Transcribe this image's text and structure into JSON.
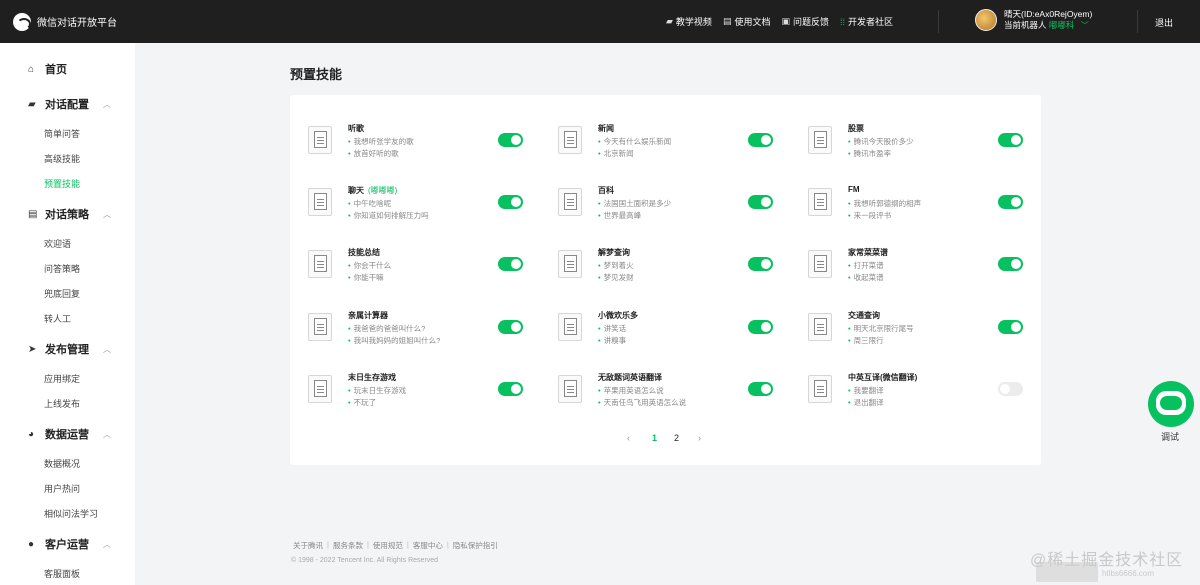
{
  "app": {
    "brand": "微信对话开放平台"
  },
  "topnav": [
    {
      "label": "教学视频",
      "icon": "video-icon"
    },
    {
      "label": "使用文档",
      "icon": "doc-icon"
    },
    {
      "label": "问题反馈",
      "icon": "feedback-icon"
    },
    {
      "label": "开发者社区",
      "icon": "community-icon"
    }
  ],
  "user": {
    "name": "晴天(ID:eAx0RejOyem)",
    "bot_prefix": "当前机器人",
    "bot_name": "嘟嘟科"
  },
  "logout": "退出",
  "sidebar": {
    "home": "首页",
    "dialog_config": {
      "label": "对话配置",
      "items": [
        "简单问答",
        "高级技能",
        "预置技能"
      ]
    },
    "dialog_strategy": {
      "label": "对话策略",
      "items": [
        "欢迎语",
        "问答策略",
        "兜底回复",
        "转人工"
      ]
    },
    "publish": {
      "label": "发布管理",
      "items": [
        "应用绑定",
        "上线发布"
      ]
    },
    "data_ops": {
      "label": "数据运营",
      "items": [
        "数据概况",
        "用户热问",
        "相似问法学习"
      ]
    },
    "customer_ops": {
      "label": "客户运营",
      "items": [
        "客服面板"
      ]
    }
  },
  "page_title": "预置技能",
  "skills": [
    {
      "name": "听歌",
      "tag": "",
      "examples": [
        "我想听张学友的歌",
        "放首好听的歌"
      ],
      "enabled": true
    },
    {
      "name": "新闻",
      "tag": "",
      "examples": [
        "今天有什么娱乐新闻",
        "北京新闻"
      ],
      "enabled": true
    },
    {
      "name": "股票",
      "tag": "",
      "examples": [
        "腾讯今天股价多少",
        "腾讯市盈率"
      ],
      "enabled": true
    },
    {
      "name": "聊天",
      "tag": "(嘟嘟嘟)",
      "examples": [
        "中午吃啥呢",
        "你知道如何排解压力吗"
      ],
      "enabled": true
    },
    {
      "name": "百科",
      "tag": "",
      "examples": [
        "法国国土面积是多少",
        "世界最高峰"
      ],
      "enabled": true
    },
    {
      "name": "FM",
      "tag": "",
      "examples": [
        "我想听郭德纲的相声",
        "来一段评书"
      ],
      "enabled": true
    },
    {
      "name": "技能总结",
      "tag": "",
      "examples": [
        "你会干什么",
        "你能干嘛"
      ],
      "enabled": true
    },
    {
      "name": "解梦查询",
      "tag": "",
      "examples": [
        "梦到着火",
        "梦见发财"
      ],
      "enabled": true
    },
    {
      "name": "家常菜菜谱",
      "tag": "",
      "examples": [
        "打开菜谱",
        "收起菜谱"
      ],
      "enabled": true
    },
    {
      "name": "亲属计算器",
      "tag": "",
      "examples": [
        "我爸爸的爸爸叫什么?",
        "我叫我妈妈的姐姐叫什么?"
      ],
      "enabled": true
    },
    {
      "name": "小微欢乐多",
      "tag": "",
      "examples": [
        "讲笑话",
        "讲糗事"
      ],
      "enabled": true
    },
    {
      "name": "交通查询",
      "tag": "",
      "examples": [
        "明天北京限行尾号",
        "周三限行"
      ],
      "enabled": true
    },
    {
      "name": "末日生存游戏",
      "tag": "",
      "examples": [
        "玩末日生存游戏",
        "不玩了"
      ],
      "enabled": true
    },
    {
      "name": "无敌题词英语翻译",
      "tag": "",
      "examples": [
        "苹果用英语怎么说",
        "天南任鸟飞用英语怎么说"
      ],
      "enabled": true
    },
    {
      "name": "中英互译(微信翻译)",
      "tag": "",
      "examples": [
        "我要翻译",
        "退出翻译"
      ],
      "enabled": false
    }
  ],
  "pagination": {
    "prev": "‹",
    "pages": [
      "1",
      "2"
    ],
    "current": "1",
    "next": "›"
  },
  "footer": {
    "links": [
      "关于腾讯",
      "服务条款",
      "使用规范",
      "客服中心",
      "隐私保护指引"
    ],
    "copyright": "© 1998 - 2022 Tencent Inc. All Rights Reserved"
  },
  "debug": {
    "label": "调试"
  },
  "watermark": {
    "text": "@稀土掘金技术社区",
    "url": "htlbs6666.com"
  },
  "colors": {
    "accent": "#07c160",
    "topbar": "#1f1f1f"
  }
}
